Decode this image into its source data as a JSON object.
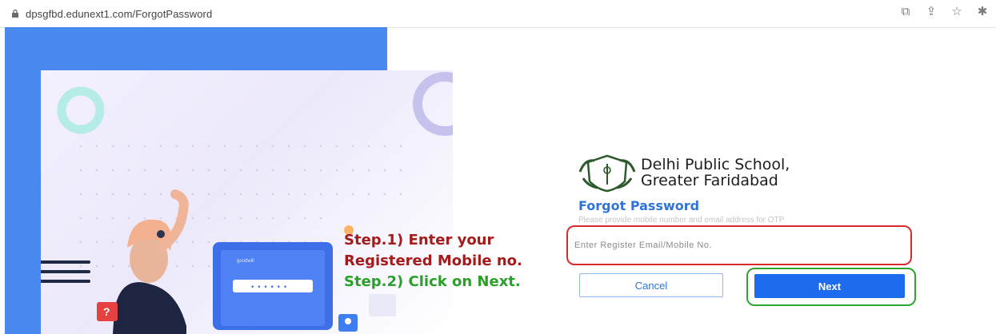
{
  "browser": {
    "url": "dpsgfbd.edunext1.com/ForgotPassword",
    "icons": [
      "lock-icon",
      "open-external-icon",
      "share-icon",
      "star-icon",
      "puzzle-icon"
    ]
  },
  "school": {
    "name_line1": "Delhi Public School,",
    "name_line2": "Greater Faridabad"
  },
  "form": {
    "heading": "Forgot Password",
    "subtext": "Please provide mobile number and email address for OTP",
    "input_placeholder": "Enter Register Email/Mobile No.",
    "input_value": "",
    "cancel_label": "Cancel",
    "next_label": "Next"
  },
  "annotation": {
    "step1_line1": "Step.1) Enter your",
    "step1_line2": "Registered Mobile no.",
    "step2": "Step.2) Click on Next."
  },
  "illustration": {
    "laptop_brand": "goodwill",
    "password_mask": "• • • • • •",
    "question_mark": "?"
  },
  "colors": {
    "accent_blue": "#4a8af0",
    "button_blue": "#1d6cf0",
    "heading_blue": "#2f74d8",
    "annotation_red": "#a51a1a",
    "annotation_green": "#2aa02a",
    "highlight_red": "#d92b2b",
    "highlight_green": "#2da52d"
  }
}
